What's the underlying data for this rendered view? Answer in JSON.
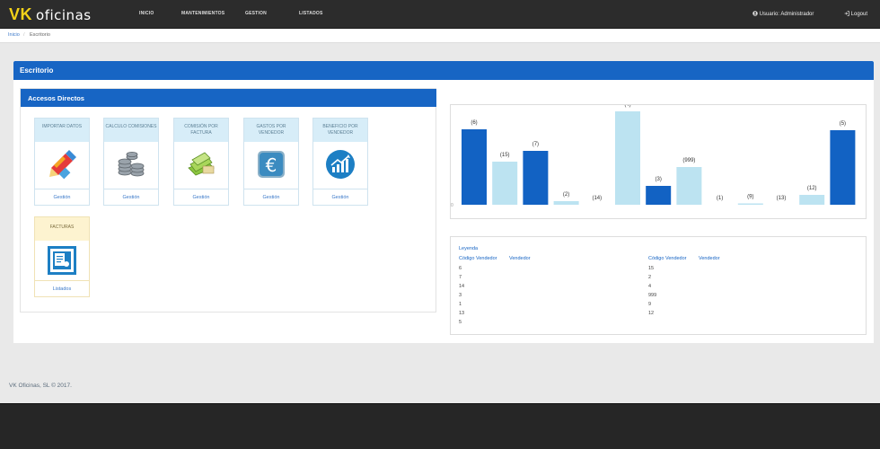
{
  "brand": {
    "vk": "VK",
    "name": "oficinas"
  },
  "nav": [
    {
      "label": "INICIO"
    },
    {
      "label": "MANTENIMIENTOS"
    },
    {
      "label": "GESTION"
    },
    {
      "label": "LISTADOS"
    }
  ],
  "user": {
    "label": "Usuario: Administrador",
    "icon": "user-icon"
  },
  "logout": {
    "label": "Logout",
    "icon": "logout-icon"
  },
  "breadcrumb": {
    "home": "Inicio",
    "separator": "/",
    "current": "Escritorio"
  },
  "panel": {
    "title": "Escritorio"
  },
  "accesos": {
    "title": "Accesos Directos",
    "tiles": [
      {
        "title": "IMPORTAR DATOS",
        "action": "Gestión",
        "icon": "import-pencil-icon"
      },
      {
        "title": "CALCULO COMISIONES",
        "action": "Gestión",
        "icon": "coins-stack-icon"
      },
      {
        "title": "COMISIÓN POR FACTURA",
        "action": "Gestión",
        "icon": "money-bills-icon"
      },
      {
        "title": "GASTOS POR VENDEDOR",
        "action": "Gestión",
        "icon": "euro-icon"
      },
      {
        "title": "BENEFICIO POR VENDEDOR",
        "action": "Gestión",
        "icon": "growth-chart-icon"
      },
      {
        "title": "FACTURAS",
        "action": "Listados",
        "icon": "invoice-document-icon"
      }
    ]
  },
  "colors": {
    "primary": "#1765c4",
    "dark_bar": "#1262c3",
    "light_bar": "#bce3f1",
    "topbar": "#2c2c2c"
  },
  "chart_data": {
    "type": "bar",
    "categories": [
      "6",
      "15",
      "7",
      "2",
      "14",
      "4",
      "3",
      "999",
      "1",
      "9",
      "13",
      "12",
      "5"
    ],
    "labels": [
      "(6)",
      "(15)",
      "(7)",
      "(2)",
      "(14)",
      "(4)",
      "(3)",
      "(999)",
      "(1)",
      "(9)",
      "(13)",
      "(12)",
      "(5)"
    ],
    "values": [
      84,
      48,
      60,
      4,
      0,
      104,
      21,
      42,
      0,
      1,
      0,
      11,
      83
    ],
    "bar_colors": [
      "#1262c3",
      "#bce3f1",
      "#1262c3",
      "#bce3f1",
      "#bce3f1",
      "#bce3f1",
      "#1262c3",
      "#bce3f1",
      "#1262c3",
      "#bce3f1",
      "#1262c3",
      "#bce3f1",
      "#1262c3"
    ],
    "ylabel": "",
    "xlabel": "",
    "title": "",
    "ylim": [
      0,
      104
    ],
    "y_tick_label": "0"
  },
  "legend": {
    "title": "Leyenda",
    "col_headers": [
      "Código Vendedor",
      "Vendedor"
    ],
    "left": [
      "6",
      "7",
      "14",
      "3",
      "1",
      "13",
      "5"
    ],
    "right": [
      "15",
      "2",
      "4",
      "999",
      "9",
      "12"
    ]
  },
  "footer": {
    "text": "VK Oficinas, SL © 2017."
  }
}
